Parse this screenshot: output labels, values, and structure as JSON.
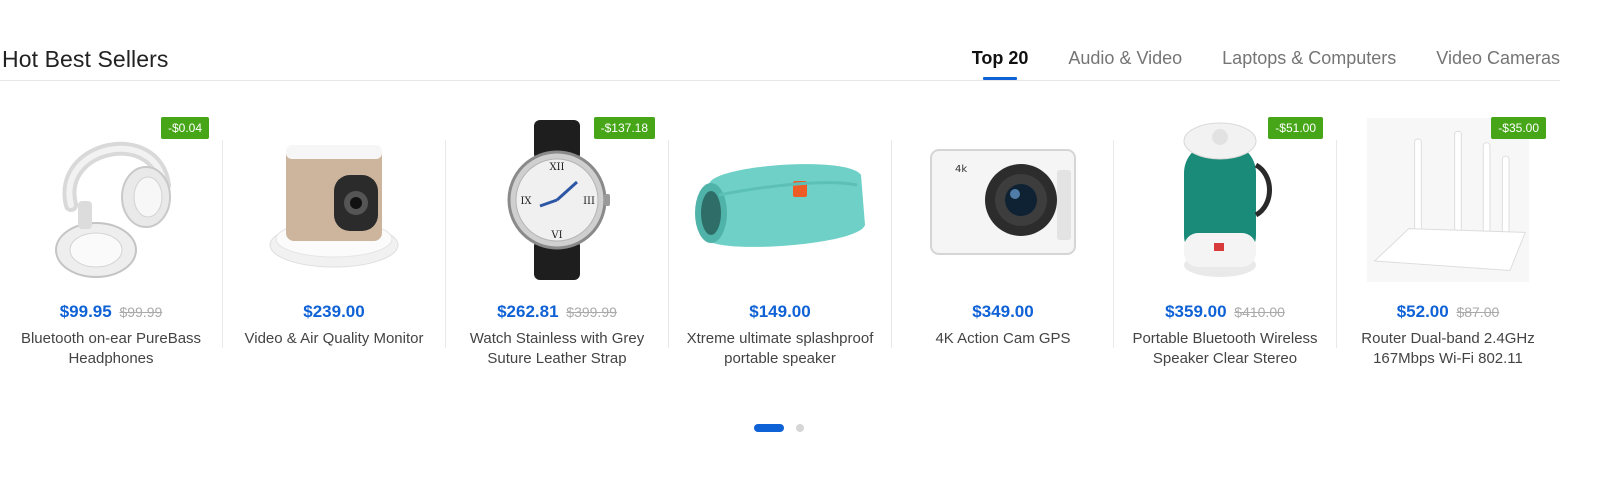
{
  "section": {
    "title": "Hot Best Sellers",
    "tabs": [
      {
        "label": "Top 20",
        "active": true
      },
      {
        "label": "Audio & Video",
        "active": false
      },
      {
        "label": "Laptops & Computers",
        "active": false
      },
      {
        "label": "Video Cameras",
        "active": false
      }
    ]
  },
  "products": [
    {
      "name": "Bluetooth on-ear PureBass Headphones",
      "price": "$99.95",
      "old_price": "$99.99",
      "badge": "-$0.04",
      "icon": "headphones-icon"
    },
    {
      "name": "Video & Air Quality Monitor",
      "price": "$239.00",
      "old_price": "",
      "badge": "",
      "icon": "home-camera-icon"
    },
    {
      "name": "Watch Stainless with Grey Suture Leather Strap",
      "price": "$262.81",
      "old_price": "$399.99",
      "badge": "-$137.18",
      "icon": "watch-icon"
    },
    {
      "name": "Xtreme ultimate splashproof portable speaker",
      "price": "$149.00",
      "old_price": "",
      "badge": "",
      "icon": "speaker-icon"
    },
    {
      "name": "4K Action Cam GPS",
      "price": "$349.00",
      "old_price": "",
      "badge": "",
      "icon": "action-camera-icon"
    },
    {
      "name": "Portable Bluetooth Wireless Speaker Clear Stereo",
      "price": "$359.00",
      "old_price": "$410.00",
      "badge": "-$51.00",
      "icon": "cylinder-speaker-icon"
    },
    {
      "name": "Router Dual-band 2.4GHz 167Mbps Wi-Fi 802.11",
      "price": "$52.00",
      "old_price": "$87.00",
      "badge": "-$35.00",
      "icon": "router-icon"
    }
  ],
  "carousel": {
    "pages": 2,
    "active": 0
  },
  "colors": {
    "accent": "#0f62d6",
    "badge": "#46a618"
  }
}
